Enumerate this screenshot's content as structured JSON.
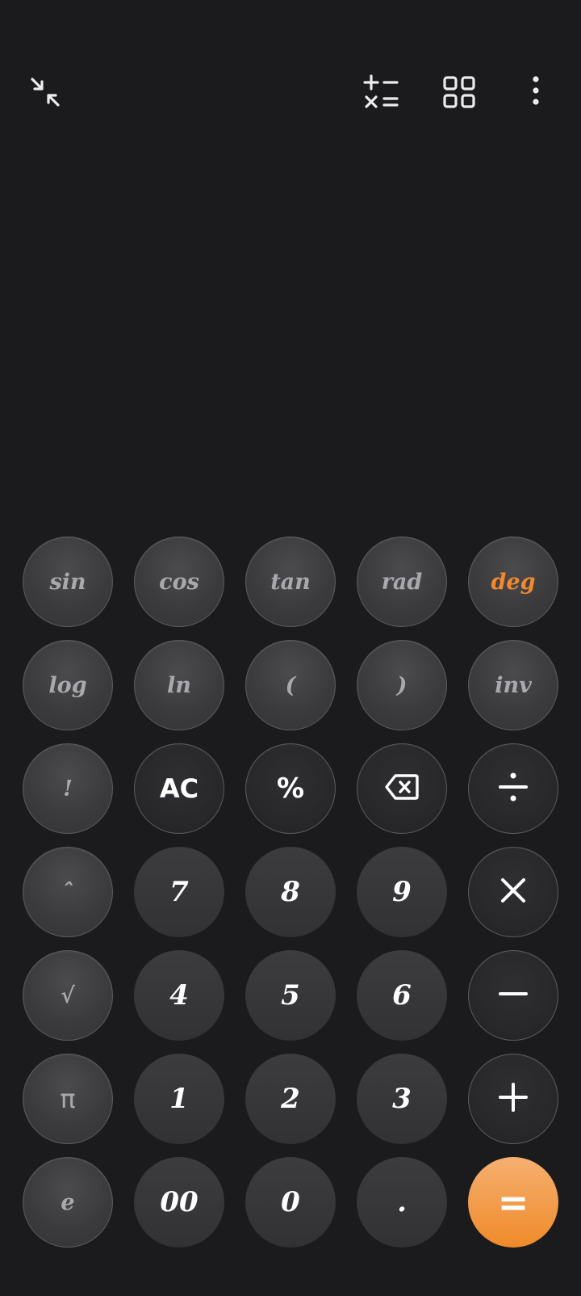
{
  "topbar": {
    "icons": [
      "minimize-icon",
      "operations-icon",
      "grid-icon",
      "more-icon"
    ]
  },
  "display": {
    "expression": "",
    "result": ""
  },
  "keypad": {
    "rows": [
      [
        {
          "label": "sin",
          "name": "sin"
        },
        {
          "label": "cos",
          "name": "cos"
        },
        {
          "label": "tan",
          "name": "tan"
        },
        {
          "label": "rad",
          "name": "rad"
        },
        {
          "label": "deg",
          "name": "deg"
        }
      ],
      [
        {
          "label": "log",
          "name": "log"
        },
        {
          "label": "ln",
          "name": "ln"
        },
        {
          "label": "(",
          "name": "open-paren"
        },
        {
          "label": ")",
          "name": "close-paren"
        },
        {
          "label": "inv",
          "name": "inv"
        }
      ],
      [
        {
          "label": "!",
          "name": "factorial"
        },
        {
          "label": "AC",
          "name": "all-clear"
        },
        {
          "label": "%",
          "name": "percent"
        },
        {
          "label": "",
          "name": "backspace"
        },
        {
          "label": "÷",
          "name": "divide"
        }
      ],
      [
        {
          "label": "ˆ",
          "name": "power"
        },
        {
          "label": "7",
          "name": "7"
        },
        {
          "label": "8",
          "name": "8"
        },
        {
          "label": "9",
          "name": "9"
        },
        {
          "label": "×",
          "name": "multiply"
        }
      ],
      [
        {
          "label": "√",
          "name": "sqrt"
        },
        {
          "label": "4",
          "name": "4"
        },
        {
          "label": "5",
          "name": "5"
        },
        {
          "label": "6",
          "name": "6"
        },
        {
          "label": "−",
          "name": "subtract"
        }
      ],
      [
        {
          "label": "π",
          "name": "pi"
        },
        {
          "label": "1",
          "name": "1"
        },
        {
          "label": "2",
          "name": "2"
        },
        {
          "label": "3",
          "name": "3"
        },
        {
          "label": "+",
          "name": "add"
        }
      ],
      [
        {
          "label": "e",
          "name": "euler"
        },
        {
          "label": "00",
          "name": "double-zero"
        },
        {
          "label": "0",
          "name": "0"
        },
        {
          "label": ".",
          "name": "decimal"
        },
        {
          "label": "=",
          "name": "equals"
        }
      ]
    ]
  },
  "colors": {
    "accent": "#f2892c",
    "background": "#1b1b1d"
  }
}
